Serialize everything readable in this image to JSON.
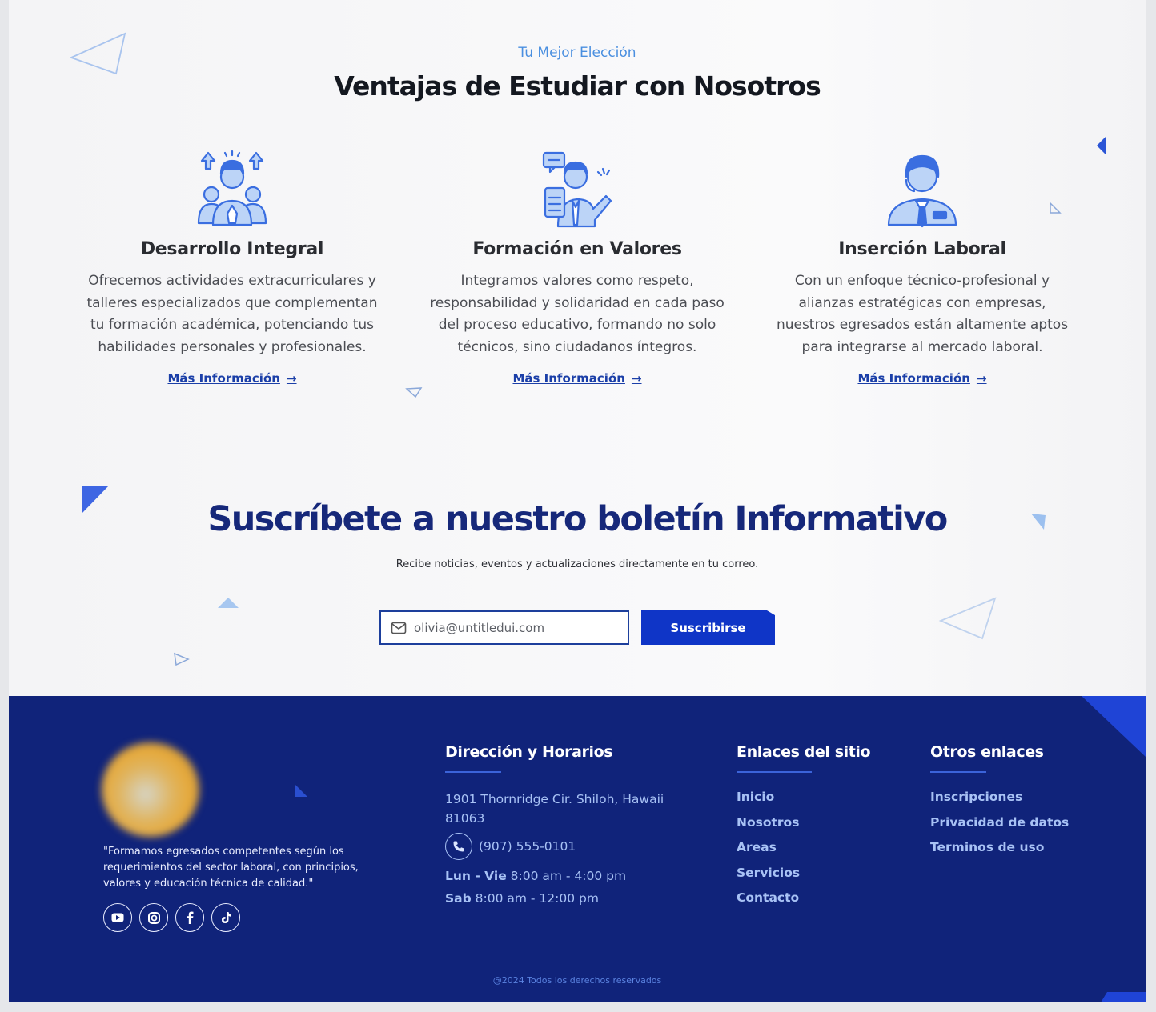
{
  "header": {
    "eyebrow": "Tu Mejor Elección",
    "title": "Ventajas de Estudiar con Nosotros"
  },
  "features": [
    {
      "icon": "team-growth-icon",
      "title": "Desarrollo Integral",
      "description": "Ofrecemos actividades extracurriculares y talleres especializados que complementan tu formación académica, potenciando tus habilidades personales y profesionales.",
      "link_label": "Más Información"
    },
    {
      "icon": "values-training-icon",
      "title": "Formación en Valores",
      "description": "Integramos valores como respeto, responsabilidad y solidaridad en cada paso del proceso educativo, formando no solo técnicos, sino ciudadanos íntegros.",
      "link_label": "Más Información"
    },
    {
      "icon": "professional-person-icon",
      "title": "Inserción Laboral",
      "description": "Con un enfoque técnico-profesional y alianzas estratégicas con empresas, nuestros egresados están altamente aptos para integrarse al mercado laboral.",
      "link_label": "Más Información"
    }
  ],
  "newsletter": {
    "title": "Suscríbete a nuestro boletín Informativo",
    "subtitle": "Recibe noticias, eventos y actualizaciones directamente en tu correo.",
    "email_placeholder": "olivia@untitledui.com",
    "button_label": "Suscribirse"
  },
  "footer": {
    "quote": "\"Formamos egresados competentes según los requerimientos del sector laboral, con principios, valores y educación técnica de calidad.\"",
    "socials": [
      "youtube-icon",
      "instagram-icon",
      "facebook-icon",
      "tiktok-icon"
    ],
    "address_title": "Dirección y Horarios",
    "address": "1901 Thornridge Cir. Shiloh, Hawaii 81063",
    "phone": "(907) 555-0101",
    "hours": [
      {
        "days": "Lun - Vie",
        "time": "8:00 am - 4:00 pm"
      },
      {
        "days": "Sab",
        "time": "8:00 am - 12:00 pm"
      }
    ],
    "site_links_title": "Enlaces del sitio",
    "site_links": [
      "Inicio",
      "Nosotros",
      "Areas",
      "Servicios",
      "Contacto"
    ],
    "other_links_title": "Otros enlaces",
    "other_links": [
      "Inscripciones",
      "Privacidad de datos",
      "Terminos de uso"
    ],
    "copyright": "@2024 Todos los derechos reservados"
  },
  "colors": {
    "accent": "#0f35c7",
    "footer_bg": "#10237a",
    "eyebrow": "#4a8fe0",
    "link": "#1b3fa8",
    "newsletter_title": "#16287a"
  }
}
